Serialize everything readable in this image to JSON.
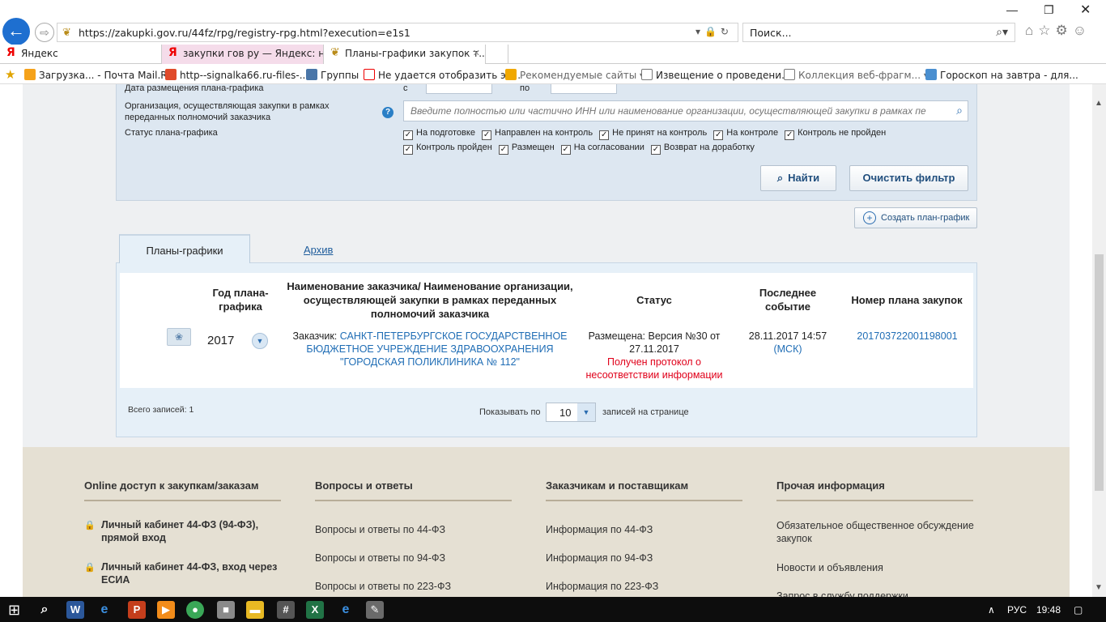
{
  "browser": {
    "url": "https://zakupki.gov.ru/44fz/rpg/registry-rpg.html?execution=e1s1",
    "search_text": "Поиск...",
    "tabs": [
      {
        "label": "Яндекс"
      },
      {
        "label": "закупки гов ру — Яндекс: на..."
      },
      {
        "label": "Планы-графики закупок т..."
      }
    ],
    "favorites": [
      {
        "label": "Загрузка... - Почта Mail.Ru"
      },
      {
        "label": "http--signalka66.ru-files-..."
      },
      {
        "label": "Группы"
      },
      {
        "label": "Не удается отобразить эт..."
      },
      {
        "label": "Рекомендуемые сайты"
      },
      {
        "label": "Извещение о проведени..."
      },
      {
        "label": "Коллекция веб-фрагм..."
      },
      {
        "label": "Гороскоп на завтра - для..."
      }
    ]
  },
  "filter": {
    "date_label": "Дата размещения плана-графика",
    "date_from_prefix": "с",
    "date_to_prefix": "по",
    "org_label": "Организация, осуществляющая закупки в рамках переданных полномочий заказчика",
    "org_placeholder": "Введите полностью или частично ИНН или наименование организации, осуществляющей закупки в рамках пе",
    "status_label": "Статус плана-графика",
    "statuses": [
      {
        "label": "На подготовке",
        "checked": true
      },
      {
        "label": "Направлен на контроль",
        "checked": true
      },
      {
        "label": "Не принят на контроль",
        "checked": true
      },
      {
        "label": "На контроле",
        "checked": true
      },
      {
        "label": "Контроль не пройден",
        "checked": true
      },
      {
        "label": "Контроль пройден",
        "checked": true
      },
      {
        "label": "Размещен",
        "checked": true
      },
      {
        "label": "На согласовании",
        "checked": true
      },
      {
        "label": "Возврат на доработку",
        "checked": true
      }
    ],
    "find_button": "Найти",
    "clear_button": "Очистить фильтр"
  },
  "create_button": "Создать план-график",
  "tabs": {
    "active": "Планы-графики",
    "archive": "Архив"
  },
  "table": {
    "headers": {
      "year": "Год плана-графика",
      "customer": "Наименование заказчика/ Наименование организации, осуществляющей закупки в рамках переданных полномочий заказчика",
      "status": "Статус",
      "event": "Последнее событие",
      "number": "Номер плана закупок"
    },
    "row": {
      "year": "2017",
      "customer_prefix": "Заказчик:",
      "customer_name": "САНКТ-ПЕТЕРБУРГСКОЕ ГОСУДАРСТВЕННОЕ БЮДЖЕТНОЕ УЧРЕЖДЕНИЕ ЗДРАВООХРАНЕНИЯ \"ГОРОДСКАЯ ПОЛИКЛИНИКА № 112\"",
      "status": "Размещена: Версия №30 от 27.11.2017",
      "status_note": "Получен протокол о несоответствии информации",
      "event_date": "28.11.2017 14:57",
      "event_tz": "(МСК)",
      "plan_number": "201703722001198001"
    },
    "total": "Всего записей: 1",
    "per_page_label": "Показывать по",
    "per_page_value": "10",
    "per_page_suffix": "записей на странице"
  },
  "footer": {
    "col1": {
      "title": "Online доступ к закупкам/заказам",
      "items": [
        "Личный кабинет 44-ФЗ (94-ФЗ), прямой вход",
        "Личный кабинет 44-ФЗ, вход через ЕСИА"
      ]
    },
    "col2": {
      "title": "Вопросы и ответы",
      "items": [
        "Вопросы и ответы по 44-ФЗ",
        "Вопросы и ответы по 94-ФЗ",
        "Вопросы и ответы по 223-ФЗ"
      ]
    },
    "col3": {
      "title": "Заказчикам и поставщикам",
      "items": [
        "Информация по 44-ФЗ",
        "Информация по 94-ФЗ",
        "Информация по 223-ФЗ"
      ]
    },
    "col4": {
      "title": "Прочая информация",
      "items": [
        "Обязательное общественное обсуждение закупок",
        "Новости и объявления",
        "Запрос в службу поддержки"
      ]
    }
  },
  "taskbar": {
    "lang": "РУС",
    "time": "19:48"
  }
}
